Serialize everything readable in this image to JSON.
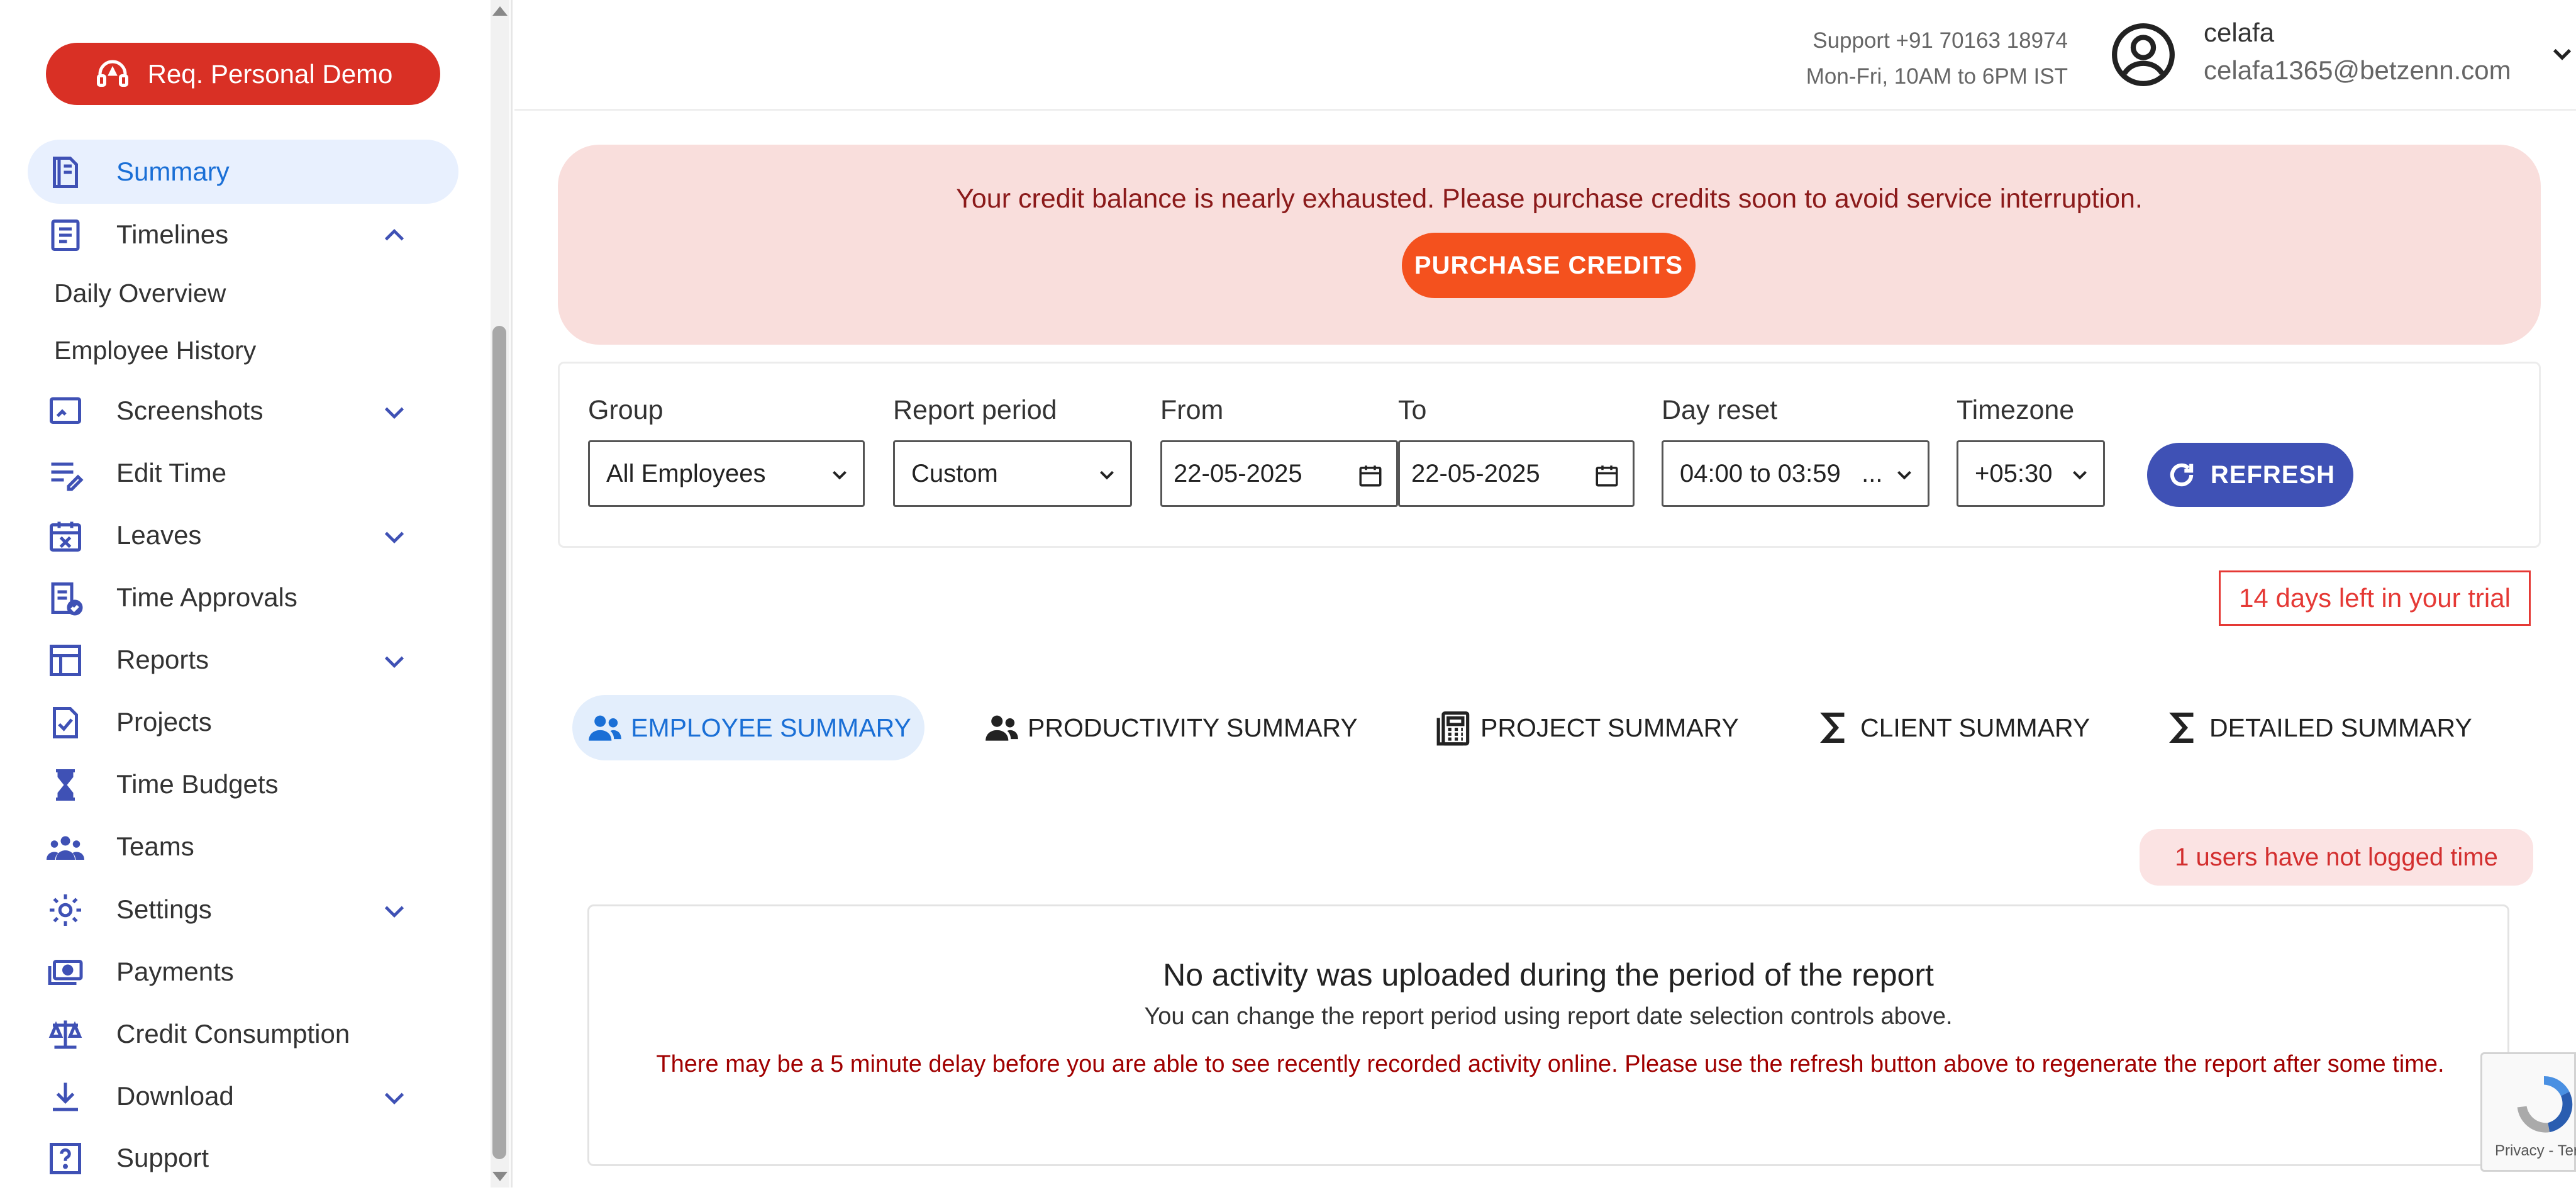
{
  "sidebar": {
    "demo_button": "Req. Personal Demo",
    "items": [
      {
        "label": "Summary",
        "icon": "summary-icon"
      },
      {
        "label": "Timelines",
        "icon": "timelines-icon"
      },
      {
        "label": "Screenshots",
        "icon": "screenshots-icon"
      },
      {
        "label": "Edit Time",
        "icon": "edit-time-icon"
      },
      {
        "label": "Leaves",
        "icon": "leaves-icon"
      },
      {
        "label": "Time Approvals",
        "icon": "time-approvals-icon"
      },
      {
        "label": "Reports",
        "icon": "reports-icon"
      },
      {
        "label": "Projects",
        "icon": "projects-icon"
      },
      {
        "label": "Time Budgets",
        "icon": "hourglass-icon"
      },
      {
        "label": "Teams",
        "icon": "teams-icon"
      },
      {
        "label": "Settings",
        "icon": "gear-icon"
      },
      {
        "label": "Payments",
        "icon": "payments-icon"
      },
      {
        "label": "Credit Consumption",
        "icon": "scale-icon"
      },
      {
        "label": "Download",
        "icon": "download-icon"
      },
      {
        "label": "Support",
        "icon": "help-icon"
      }
    ],
    "timelines_sub": [
      "Daily Overview",
      "Employee History"
    ]
  },
  "header": {
    "support_phone": "Support +91 70163 18974",
    "support_hours": "Mon-Fri, 10AM to 6PM IST",
    "user_name": "celafa",
    "user_email": "celafa1365@betzenn.com"
  },
  "alert": {
    "message": "Your credit balance is nearly exhausted. Please purchase credits soon to avoid service interruption.",
    "button": "PURCHASE CREDITS"
  },
  "filters": {
    "group_label": "Group",
    "group_value": "All Employees",
    "period_label": "Report period",
    "period_value": "Custom",
    "from_label": "From",
    "from_value": "22-05-2025",
    "to_label": "To",
    "to_value": "22-05-2025",
    "dayreset_label": "Day reset",
    "dayreset_value": "04:00 to 03:59   ...",
    "timezone_label": "Timezone",
    "timezone_value": "+05:30",
    "refresh_button": "REFRESH"
  },
  "trial_notice": "14 days left in your trial",
  "tabs": [
    {
      "label": "EMPLOYEE SUMMARY",
      "active": true
    },
    {
      "label": "PRODUCTIVITY SUMMARY"
    },
    {
      "label": "PROJECT SUMMARY"
    },
    {
      "label": "CLIENT SUMMARY"
    },
    {
      "label": "DETAILED SUMMARY"
    }
  ],
  "not_logged_badge": "1 users have not logged time",
  "empty_state": {
    "title": "No activity was uploaded during the period of the report",
    "subtitle": "You can change the report period using report date selection controls above.",
    "warning": "There may be a 5 minute delay before you are able to see recently recorded activity online. Please use the refresh button above to regenerate the report after some time."
  },
  "recaptcha_text": "Privacy - Ter",
  "colors": {
    "brand_red": "#d93025",
    "accent_blue": "#3f51b5",
    "active_blue": "#1a6fd6",
    "alert_bg": "#f9dedc",
    "purchase_orange": "#f4511e"
  }
}
